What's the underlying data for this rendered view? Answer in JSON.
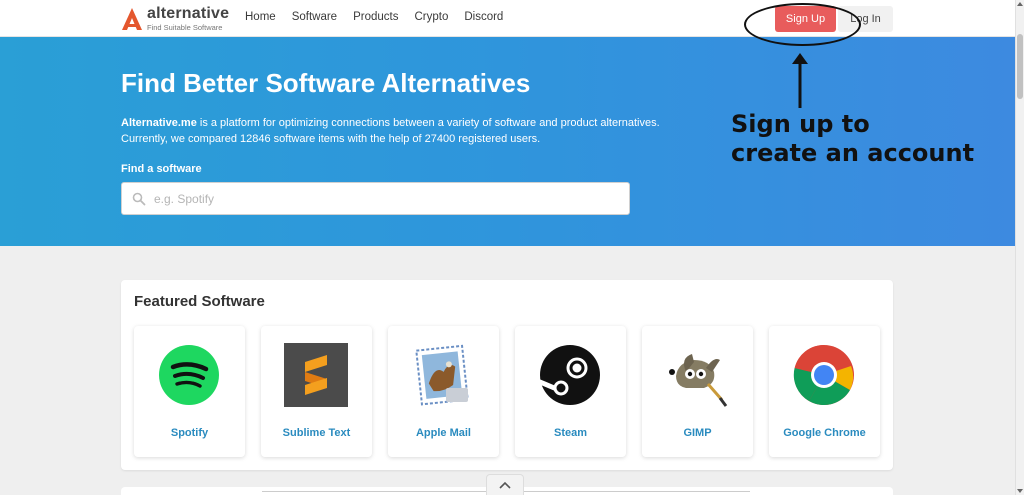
{
  "header": {
    "logo_name": "alternative",
    "logo_tagline": "Find Suitable Software",
    "nav": [
      "Home",
      "Software",
      "Products",
      "Crypto",
      "Discord"
    ],
    "signup_label": "Sign Up",
    "login_label": "Log In"
  },
  "hero": {
    "title": "Find Better Software Alternatives",
    "desc_brand": "Alternative.me",
    "desc_rest": " is a platform for optimizing connections between a variety of software and product alternatives. Currently, we compared 12846 software items with the help of 27400 registered users.",
    "find_label": "Find a software",
    "search_placeholder": "e.g. Spotify"
  },
  "annotation": {
    "line1": "Sign up to",
    "line2": "create an account"
  },
  "featured": {
    "title": "Featured Software",
    "items": [
      {
        "name": "Spotify",
        "icon": "spotify-icon"
      },
      {
        "name": "Sublime Text",
        "icon": "sublime-text-icon"
      },
      {
        "name": "Apple Mail",
        "icon": "apple-mail-icon"
      },
      {
        "name": "Steam",
        "icon": "steam-icon"
      },
      {
        "name": "GIMP",
        "icon": "gimp-icon"
      },
      {
        "name": "Google Chrome",
        "icon": "chrome-icon"
      }
    ]
  },
  "colors": {
    "accent": "#e85c5c",
    "hero_start": "#2a9fd6",
    "hero_end": "#3d8ae0",
    "link": "#2a8bbf"
  }
}
